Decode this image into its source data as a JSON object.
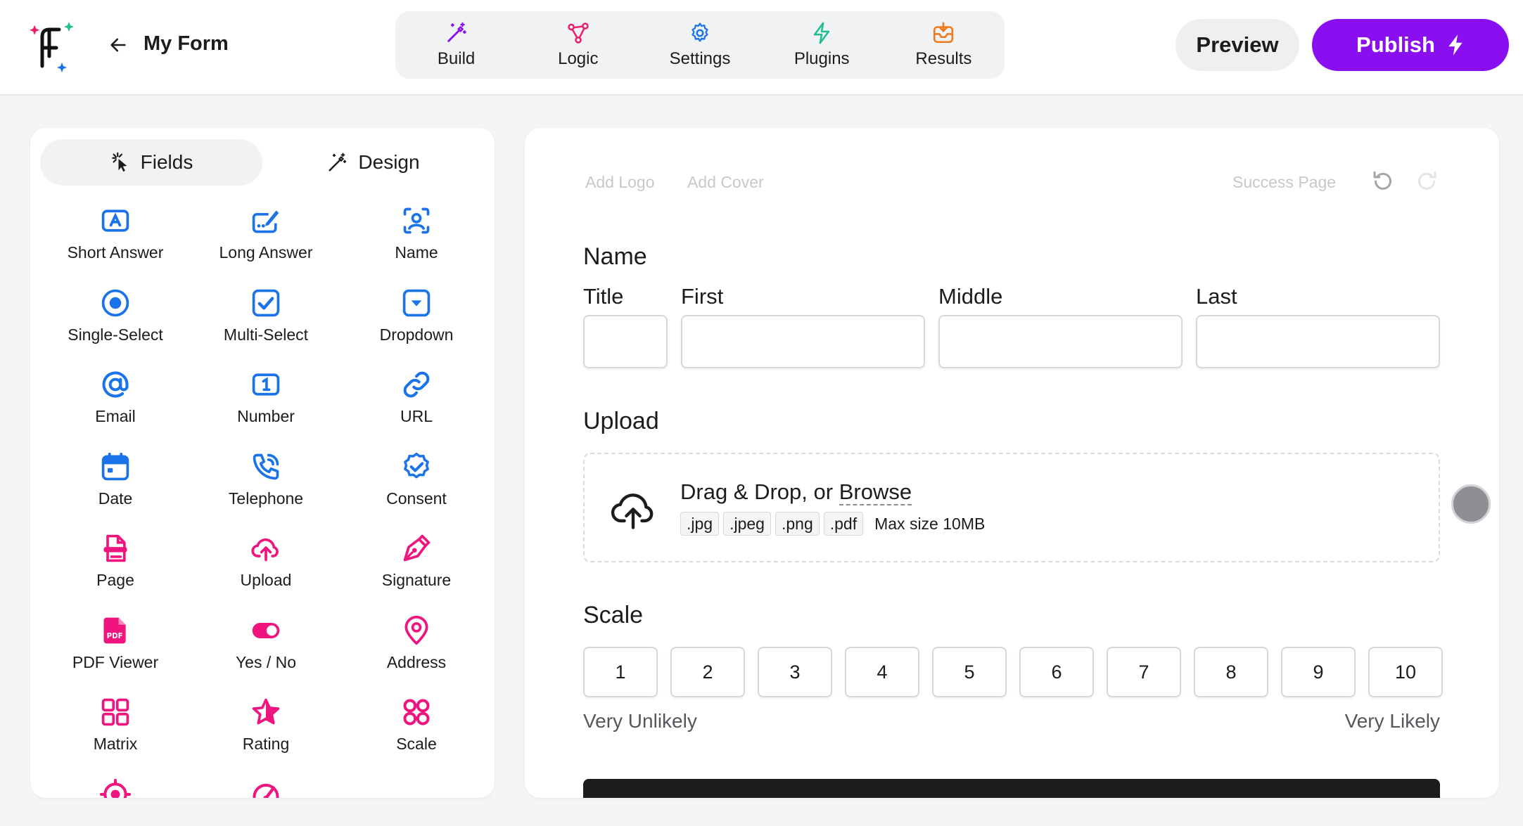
{
  "header": {
    "back_label": "My Form",
    "nav": [
      {
        "id": "build",
        "label": "Build",
        "icon": "magic-wand-icon",
        "color": "#8a0ff0"
      },
      {
        "id": "logic",
        "label": "Logic",
        "icon": "logic-nodes-icon",
        "color": "#e8216b"
      },
      {
        "id": "settings",
        "label": "Settings",
        "icon": "gear-icon",
        "color": "#1a73e8"
      },
      {
        "id": "plugins",
        "label": "Plugins",
        "icon": "lightning-icon",
        "color": "#1fbf8f"
      },
      {
        "id": "results",
        "label": "Results",
        "icon": "inbox-icon",
        "color": "#f07a1a"
      }
    ],
    "preview_label": "Preview",
    "publish_label": "Publish"
  },
  "colors": {
    "accent": "#8a0ff0",
    "field_blue": "#1a73e8",
    "field_pink": "#f0157e"
  },
  "panel": {
    "tabs": [
      {
        "label": "Fields",
        "icon": "pointer-click-icon",
        "active": true
      },
      {
        "label": "Design",
        "icon": "magic-wand-icon",
        "active": false
      }
    ],
    "fields": [
      {
        "label": "Short Answer",
        "icon": "short-answer-icon"
      },
      {
        "label": "Long Answer",
        "icon": "long-answer-icon"
      },
      {
        "label": "Name",
        "icon": "name-icon"
      },
      {
        "label": "Single-Select",
        "icon": "single-select-icon"
      },
      {
        "label": "Multi-Select",
        "icon": "multi-select-icon"
      },
      {
        "label": "Dropdown",
        "icon": "dropdown-icon"
      },
      {
        "label": "Email",
        "icon": "at-icon"
      },
      {
        "label": "Number",
        "icon": "number-icon"
      },
      {
        "label": "URL",
        "icon": "link-icon"
      },
      {
        "label": "Date",
        "icon": "calendar-icon"
      },
      {
        "label": "Telephone",
        "icon": "phone-icon"
      },
      {
        "label": "Consent",
        "icon": "check-badge-icon"
      },
      {
        "label": "Page",
        "icon": "page-icon"
      },
      {
        "label": "Upload",
        "icon": "cloud-upload-icon"
      },
      {
        "label": "Signature",
        "icon": "pen-nib-icon"
      },
      {
        "label": "PDF Viewer",
        "icon": "pdf-icon"
      },
      {
        "label": "Yes / No",
        "icon": "toggle-icon"
      },
      {
        "label": "Address",
        "icon": "map-pin-icon"
      },
      {
        "label": "Matrix",
        "icon": "grid-icon"
      },
      {
        "label": "Rating",
        "icon": "star-icon"
      },
      {
        "label": "Scale",
        "icon": "scale-dots-icon"
      }
    ]
  },
  "canvas": {
    "add_logo": "Add Logo",
    "add_cover": "Add Cover",
    "success_page": "Success Page",
    "name_section": {
      "title": "Name",
      "subfields": [
        "Title",
        "First",
        "Middle",
        "Last"
      ]
    },
    "upload_section": {
      "title": "Upload",
      "prompt": "Drag & Drop, or",
      "browse": "Browse",
      "extensions": [
        ".jpg",
        ".jpeg",
        ".png",
        ".pdf"
      ],
      "max_size": "Max size 10MB"
    },
    "scale_section": {
      "title": "Scale",
      "values": [
        "1",
        "2",
        "3",
        "4",
        "5",
        "6",
        "7",
        "8",
        "9",
        "10"
      ],
      "low_label": "Very Unlikely",
      "high_label": "Very Likely"
    }
  }
}
